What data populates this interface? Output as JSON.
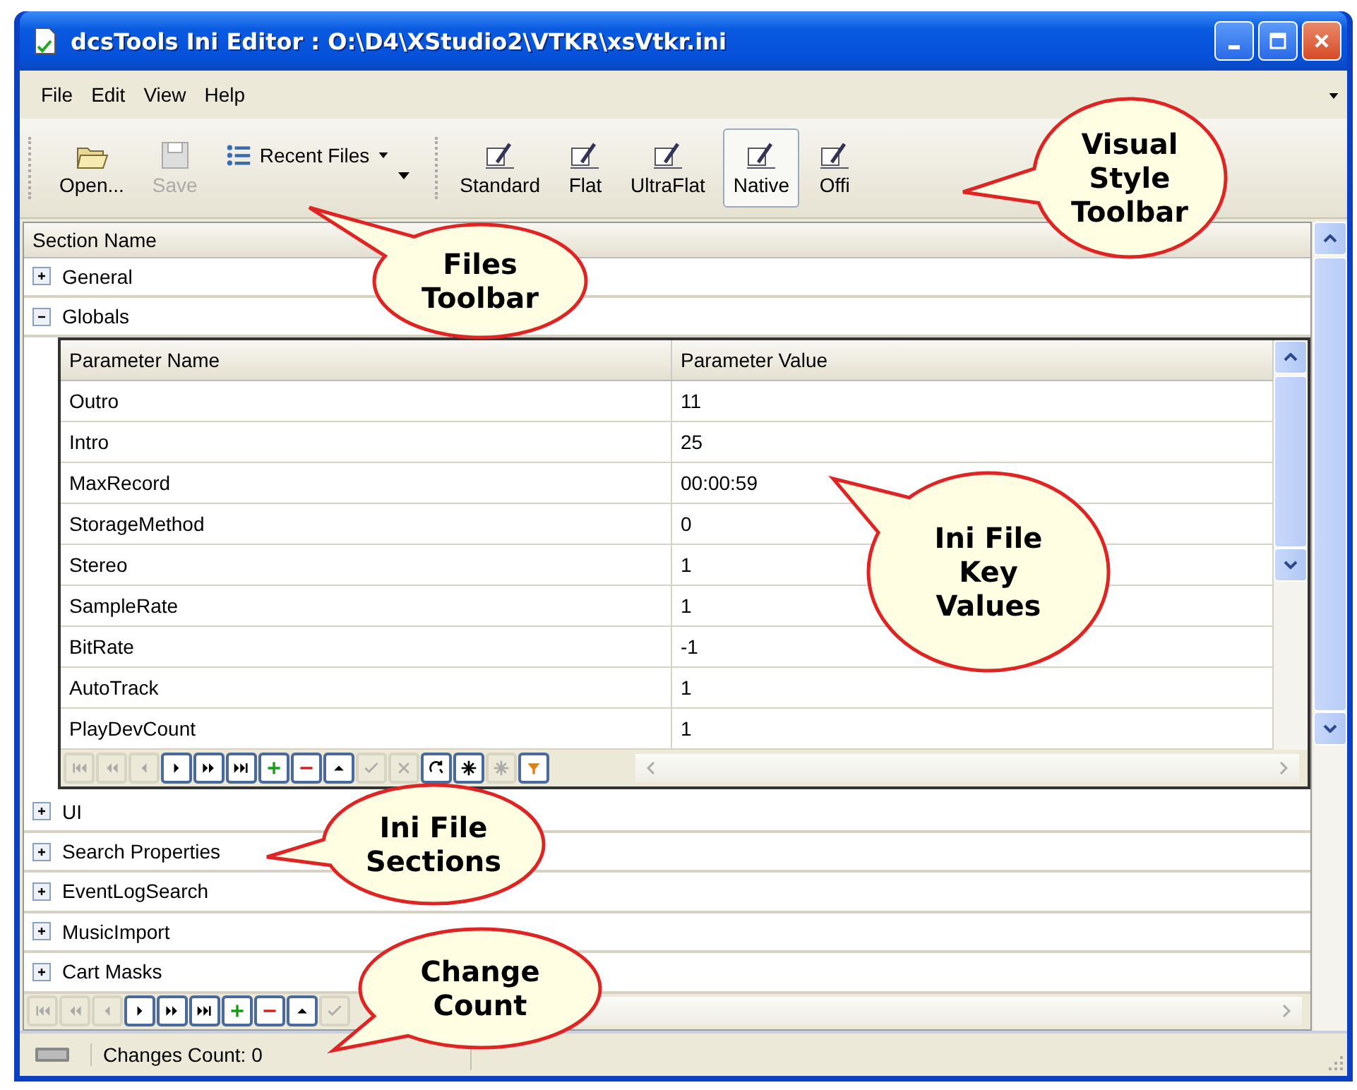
{
  "window": {
    "title": "dcsTools Ini Editor : O:\\D4\\XStudio2\\VTKR\\xsVtkr.ini"
  },
  "menu": [
    {
      "label": "File"
    },
    {
      "label": "Edit"
    },
    {
      "label": "View"
    },
    {
      "label": "Help"
    }
  ],
  "files_toolbar": [
    {
      "label": "Open...",
      "kind": "open",
      "disabled": false
    },
    {
      "label": "Save",
      "kind": "save",
      "disabled": true
    },
    {
      "label": "Recent Files",
      "kind": "recent",
      "disabled": false
    }
  ],
  "style_toolbar": [
    {
      "label": "Standard",
      "selected": false
    },
    {
      "label": "Flat",
      "selected": false
    },
    {
      "label": "UltraFlat",
      "selected": false
    },
    {
      "label": "Native",
      "selected": true
    },
    {
      "label": "Offi",
      "selected": false
    }
  ],
  "sections": {
    "column": "Section Name",
    "items": [
      {
        "name": "General",
        "expanded": false
      },
      {
        "name": "Globals",
        "expanded": true,
        "parameters": {
          "columns": [
            "Parameter Name",
            "Parameter Value"
          ],
          "rows": [
            {
              "name": "Outro",
              "value": "11"
            },
            {
              "name": "Intro",
              "value": "25"
            },
            {
              "name": "MaxRecord",
              "value": "00:00:59"
            },
            {
              "name": "StorageMethod",
              "value": "0"
            },
            {
              "name": "Stereo",
              "value": "1"
            },
            {
              "name": "SampleRate",
              "value": "1"
            },
            {
              "name": "BitRate",
              "value": "-1"
            },
            {
              "name": "AutoTrack",
              "value": "1"
            },
            {
              "name": "PlayDevCount",
              "value": "1"
            }
          ],
          "navigator": [
            {
              "kind": "first",
              "disabled": true
            },
            {
              "kind": "prev-page",
              "disabled": true
            },
            {
              "kind": "prev",
              "disabled": true
            },
            {
              "kind": "next",
              "disabled": false
            },
            {
              "kind": "next-page",
              "disabled": false
            },
            {
              "kind": "last",
              "disabled": false
            },
            {
              "kind": "add",
              "disabled": false
            },
            {
              "kind": "delete",
              "disabled": false
            },
            {
              "kind": "edit",
              "disabled": false
            },
            {
              "kind": "confirm",
              "disabled": true
            },
            {
              "kind": "cancel",
              "disabled": true
            },
            {
              "kind": "refresh",
              "disabled": false
            },
            {
              "kind": "star",
              "disabled": false
            },
            {
              "kind": "star",
              "disabled": true
            },
            {
              "kind": "filter",
              "disabled": false
            }
          ]
        }
      },
      {
        "name": "UI",
        "expanded": false
      },
      {
        "name": "Search Properties",
        "expanded": false
      },
      {
        "name": "EventLogSearch",
        "expanded": false
      },
      {
        "name": "MusicImport",
        "expanded": false
      },
      {
        "name": "Cart Masks",
        "expanded": false
      }
    ],
    "navigator": [
      {
        "kind": "first",
        "disabled": true
      },
      {
        "kind": "prev-page",
        "disabled": true
      },
      {
        "kind": "prev",
        "disabled": true
      },
      {
        "kind": "next",
        "disabled": false
      },
      {
        "kind": "next-page",
        "disabled": false
      },
      {
        "kind": "last",
        "disabled": false
      },
      {
        "kind": "add",
        "disabled": false
      },
      {
        "kind": "delete",
        "disabled": false
      },
      {
        "kind": "edit",
        "disabled": false
      },
      {
        "kind": "confirm",
        "disabled": true
      }
    ]
  },
  "status_bar": {
    "text": "Changes Count: 0"
  },
  "callouts": [
    {
      "text": "Visual\nStyle\nToolbar"
    },
    {
      "text": "Files\nToolbar"
    },
    {
      "text": "Ini File\nKey\nValues"
    },
    {
      "text": "Ini File\nSections"
    },
    {
      "text": "Change\nCount"
    }
  ]
}
